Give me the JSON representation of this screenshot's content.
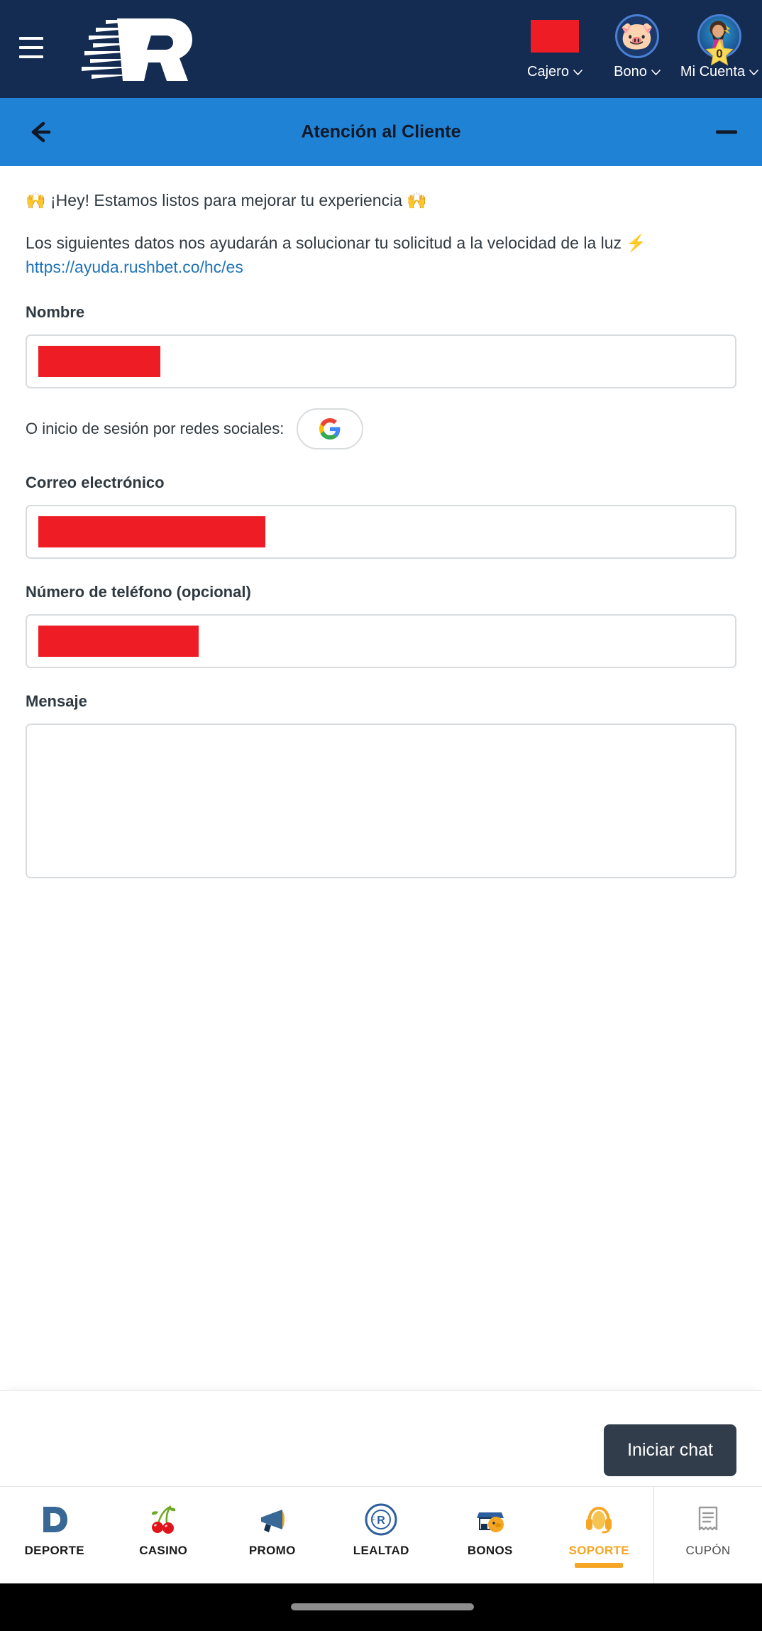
{
  "brand": {
    "menu_icon": "hamburger-icon",
    "logo_alt": "Rushbet R logo",
    "actions": [
      {
        "label": "Cajero",
        "icon": "cashier-icon",
        "caret": "chevron-down-icon"
      },
      {
        "label": "Bono",
        "icon": "piggy-bank-icon",
        "caret": "chevron-down-icon"
      },
      {
        "label": "Mi Cuenta",
        "icon": "avatar-zeus-icon",
        "caret": "chevron-down-icon",
        "badge": "0"
      }
    ]
  },
  "chat_header": {
    "back_icon": "arrow-left-icon",
    "title": "Atención al Cliente",
    "minimize_icon": "minimize-icon"
  },
  "chat_body": {
    "greeting": "🙌 ¡Hey! Estamos listos para mejorar tu experiencia 🙌",
    "intro_text": "Los siguientes datos nos ayudarán a solucionar tu solicitud a la velocidad de la luz ⚡",
    "help_link": "https://ayuda.rushbet.co/hc/es",
    "fields": {
      "name": {
        "label": "Nombre",
        "value": "",
        "placeholder": ""
      },
      "email": {
        "label": "Correo electrónico",
        "value": "",
        "placeholder": ""
      },
      "phone": {
        "label": "Número de teléfono (opcional)",
        "value": "",
        "placeholder": ""
      },
      "message": {
        "label": "Mensaje",
        "value": "",
        "placeholder": ""
      }
    },
    "social": {
      "label": "O inicio de sesión por redes sociales:",
      "google_icon": "google-icon"
    }
  },
  "chat_footer": {
    "start_chat_label": "Iniciar chat"
  },
  "bottom_nav": {
    "items": [
      {
        "label": "DEPORTE",
        "icon": "deporte-d-icon",
        "active": false
      },
      {
        "label": "CASINO",
        "icon": "cherries-icon",
        "active": false
      },
      {
        "label": "PROMO",
        "icon": "megaphone-icon",
        "active": false
      },
      {
        "label": "LEALTAD",
        "icon": "rush-rewards-seal-icon",
        "active": false
      },
      {
        "label": "BONOS",
        "icon": "shop-piggy-icon",
        "active": false
      },
      {
        "label": "SOPORTE",
        "icon": "headset-icon",
        "active": true
      }
    ],
    "coupon": {
      "label": "CUPÓN",
      "icon": "receipt-icon"
    }
  },
  "colors": {
    "brand_navy": "#142b52",
    "chat_blue": "#1f82d5",
    "redaction_red": "#ee1c25",
    "accent_amber": "#f5a623",
    "button_dark": "#313d4b",
    "link_blue": "#1f73b7"
  }
}
